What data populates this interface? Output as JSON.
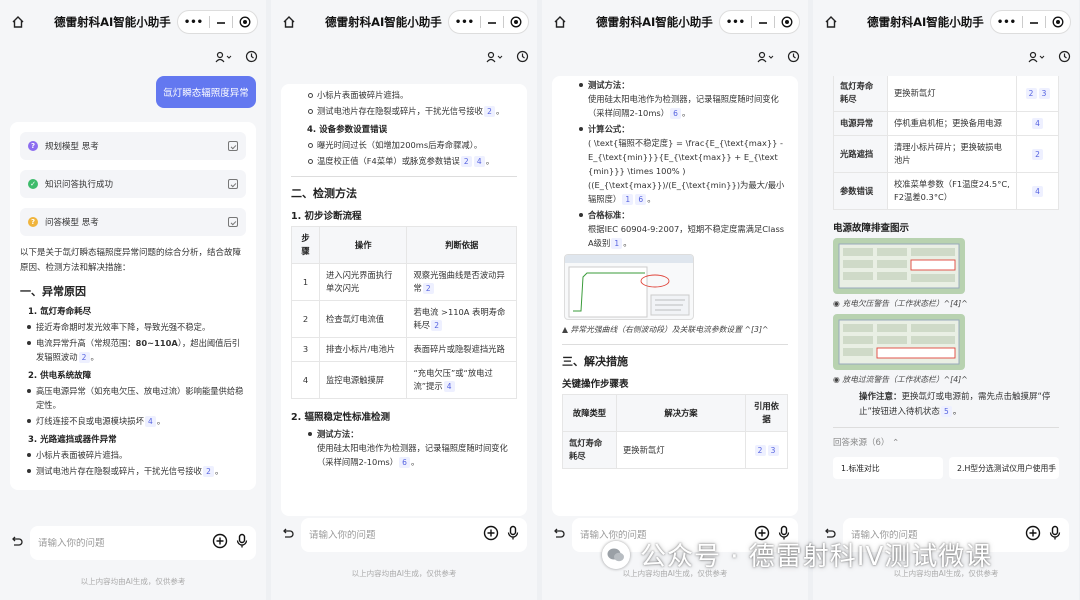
{
  "app": {
    "title": "德雷射科AI智能小助手",
    "input_placeholder": "请输入你的问题",
    "disclaimer": "以上内容均由AI生成，仅供参考"
  },
  "colors": {
    "accent": "#6378f0",
    "cite_bg": "#eef0ff",
    "cite_fg": "#5563e0"
  },
  "icons": [
    "home-icon",
    "more-dots-icon",
    "minimize-icon",
    "target-icon",
    "user-icon",
    "chevron-down-icon",
    "history-icon",
    "attach-icon",
    "plus-circle-icon",
    "mic-icon"
  ],
  "panel1": {
    "question": "氙灯瞬态辐照度异常",
    "steps": [
      {
        "label": "规划模型 思考",
        "icon": "?",
        "color": "#8c6cf0"
      },
      {
        "label": "知识问答执行成功",
        "icon": "✓",
        "color": "#3dbb6b"
      },
      {
        "label": "问答模型 思考",
        "icon": "?",
        "color": "#f0b43c"
      }
    ],
    "intro": "以下是关于氙灯瞬态辐照度异常问题的综合分析，结合故障原因、检测方法和解决措施：",
    "h1": "一、异常原因",
    "s1_title": "1. 氙灯寿命耗尽",
    "s1_b1": "接近寿命期时发光效率下降，导致光强不稳定。",
    "s1_b2_pre": "电流异常升高（常规范围：",
    "s1_b2_bold": "80~110A",
    "s1_b2_post": "），超出阈值后引发辐照波动",
    "s1_b2_cite": "2",
    "s2_title": "2. 供电系统故障",
    "s2_b1": "高压电源异常（如充电欠压、放电过流）影响能量供给稳定性。",
    "s2_b2": "灯线连接不良或电源模块损坏",
    "s2_b2_cite": "4",
    "s3_title": "3. 光路遮挡或器件异常",
    "s3_b1": "小标片表面被碎片遮挡。",
    "s3_b2": "测试电池片存在隐裂或碎片，干扰光信号接收",
    "s3_b2_cite": "2"
  },
  "panel2": {
    "top_b1": "小标片表面被碎片遮挡。",
    "top_b2": "测试电池片存在隐裂或碎片，干扰光信号接收",
    "top_b2_cite": "2",
    "s4_title": "4. 设备参数设置错误",
    "s4_b1": "曝光时间过长（如增加200ms后寿命骤减）。",
    "s4_b2": "温度校正值（F4菜单）或脉宽参数错误",
    "s4_b2_cites": [
      "2",
      "4"
    ],
    "h1": "二、检测方法",
    "sub1": "1. 初步诊断流程",
    "table_headers": [
      "步骤",
      "操作",
      "判断依据"
    ],
    "table_rows": [
      {
        "step": "1",
        "op": "进入闪光界面执行单次闪光",
        "basis": "观察光强曲线是否波动异常",
        "cite": "2"
      },
      {
        "step": "2",
        "op": "检查氙灯电流值",
        "basis": "若电流 >110A 表明寿命耗尽",
        "cite": "2"
      },
      {
        "step": "3",
        "op": "排查小标片/电池片",
        "basis": "表面碎片或隐裂遮挡光路",
        "cite": ""
      },
      {
        "step": "4",
        "op": "监控电源触摸屏",
        "basis": "“充电欠压”或“放电过流”提示",
        "cite": "4"
      }
    ],
    "sub2": "2. 辐照稳定性标准检测",
    "method_label": "测试方法：",
    "method_text": "使用硅太阳电池作为检测器，记录辐照度随时间变化（采样间隔2-10ms）",
    "method_cite": "6"
  },
  "panel3": {
    "method_label": "测试方法：",
    "method_text": "使用硅太阳电池作为检测器，记录辐照度随时间变化（采样间隔2-10ms）",
    "method_cite": "6",
    "formula_label": "计算公式：",
    "formula_text": "( \\text{辐照不稳定度} = \\frac{E_{\\text{max}} - E_{\\text{min}}}{E_{\\text{max}} + E_{\\text{min}}} \\times 100% )",
    "formula_text2": "((E_{\\text{max}})/(E_{\\text{min}})为最大/最小辐照度）",
    "formula_cites": [
      "1",
      "6"
    ],
    "std_label": "合格标准：",
    "std_text": "根据IEC 60904-9:2007，短期不稳定度需满足Class A级别",
    "std_cite": "1",
    "fig_caption": "▲ 异常光强曲线（右侧波动段）及关联电流参数设置 ^[3]^",
    "h1": "三、解决措施",
    "sub1": "关键操作步骤表",
    "table_headers": [
      "故障类型",
      "解决方案",
      "引用依据"
    ],
    "table_rows": [
      {
        "type": "氙灯寿命耗尽",
        "solution": "更换新氙灯",
        "cites": [
          "2",
          "3"
        ]
      }
    ]
  },
  "panel4": {
    "table_rows": [
      {
        "type": "氙灯寿命耗尽",
        "solution": "更换新氙灯",
        "cites": [
          "2",
          "3"
        ]
      },
      {
        "type": "电源异常",
        "solution": "停机重启机柜；更换备用电源",
        "cites": [
          "4"
        ]
      },
      {
        "type": "光路遮挡",
        "solution": "清理小标片碎片；更换破损电池片",
        "cites": [
          "2"
        ]
      },
      {
        "type": "参数错误",
        "solution": "校准菜单参数（F1温度24.5°C, F2温差0.3°C）",
        "cites": [
          "4"
        ]
      }
    ],
    "fig_title": "电源故障排查图示",
    "fig1_caption": "◉ 充电欠压警告（工作状态栏）^[4]^",
    "fig2_caption": "◉ 放电过流警告（工作状态栏）^[4]^",
    "note_label": "操作注意：",
    "note_text": "更换氙灯或电源前，需先点击触摸屏“停止”按钮进入待机状态",
    "note_cite": "5",
    "sources_label": "回答来源（6）",
    "sources": [
      "1.标准对比",
      "2.H型分选测试仪用户使用手"
    ]
  },
  "watermark": {
    "text": "公众号 · 德雷射科IV测试微课"
  }
}
